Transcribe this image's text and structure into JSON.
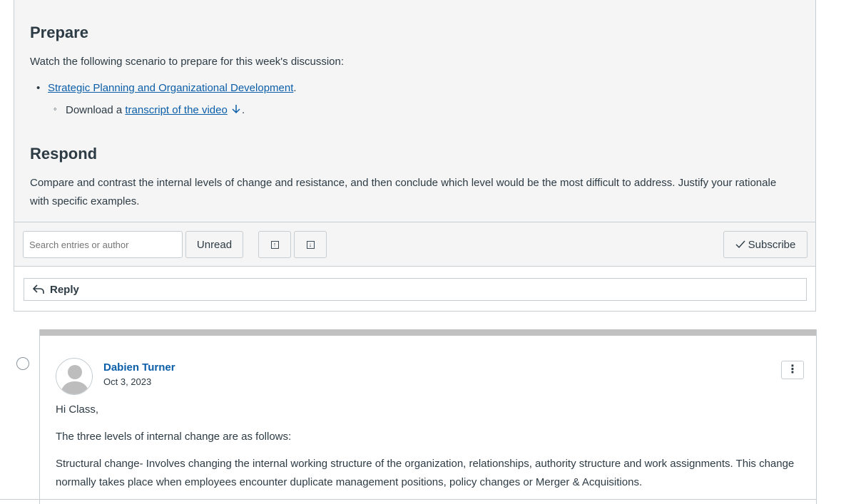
{
  "prepare": {
    "heading": "Prepare",
    "intro": "Watch the following scenario to prepare for this week's discussion:",
    "link": "Strategic Planning and Organizational Development",
    "link_suffix": ".",
    "download_prefix": "Download a ",
    "download_link": "transcript of the video",
    "download_suffix": "."
  },
  "respond": {
    "heading": "Respond",
    "text": "Compare and contrast the internal levels of change and resistance, and then conclude which level would be the most difficult to address. Justify your rationale with specific examples."
  },
  "toolbar": {
    "search_placeholder": "Search entries or author",
    "unread_label": "Unread",
    "subscribe_label": "Subscribe"
  },
  "reply": {
    "label": "Reply"
  },
  "entry": {
    "author": "Dabien Turner",
    "date": "Oct 3, 2023",
    "greeting": "Hi Class,",
    "line1": "The three levels of internal change are as follows:",
    "line2": "Structural change- Involves changing the internal working structure of the organization, relationships, authority structure and work assignments. This change normally takes place when employees encounter duplicate management positions, policy changes or Merger & Acquisitions."
  },
  "colors": {
    "link": "#0b5ea8",
    "text": "#2d3b45",
    "border": "#c7cdd1"
  }
}
